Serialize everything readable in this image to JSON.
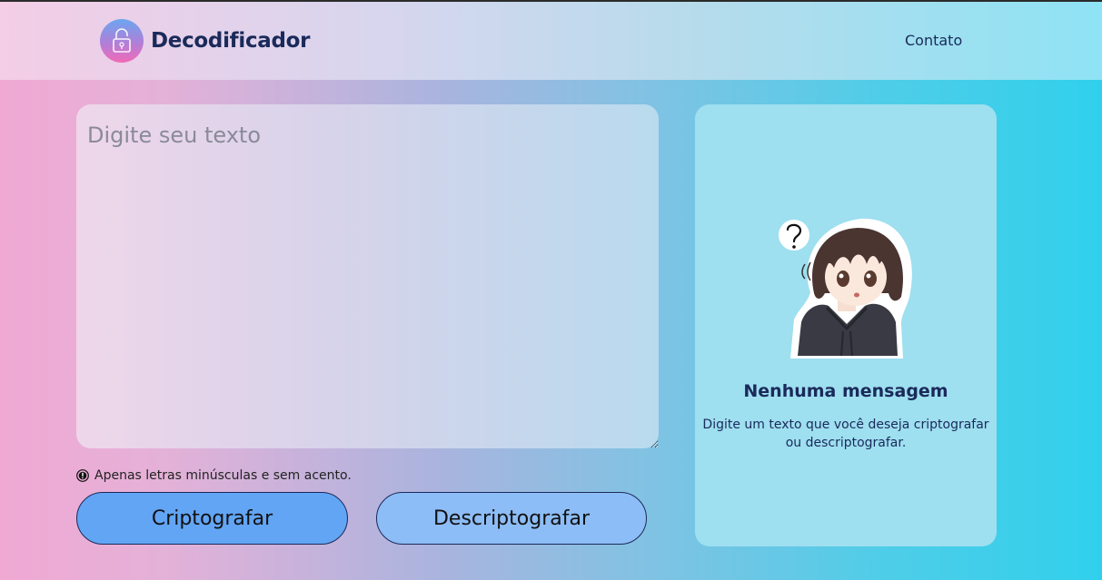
{
  "header": {
    "brand_title": "Decodificador",
    "nav": {
      "contact": "Contato"
    }
  },
  "input": {
    "placeholder": "Digite seu texto",
    "value": ""
  },
  "hint": {
    "icon": "exclamation-icon",
    "text": "Apenas letras minúsculas e sem acento."
  },
  "buttons": {
    "encrypt": "Criptografar",
    "decrypt": "Descriptografar"
  },
  "output": {
    "title": "Nenhuma mensagem",
    "description": "Digite um texto que você deseja criptografar ou descriptografar."
  },
  "colors": {
    "brand_text": "#1a2a5a",
    "encrypt_button": "#62a5f5",
    "decrypt_button": "#8dbdf6",
    "output_panel": "#9edff0"
  }
}
